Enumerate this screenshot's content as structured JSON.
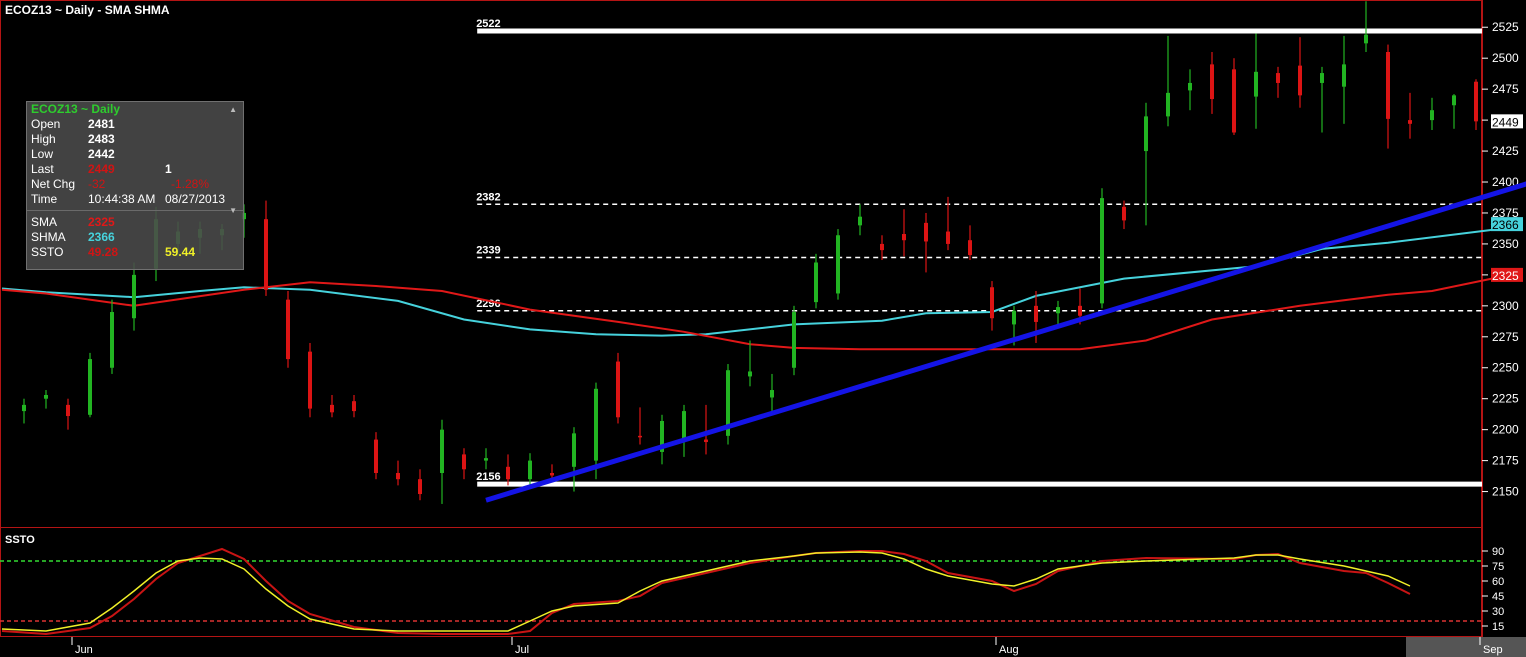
{
  "title": "ECOZ13 ~ Daily  -  SMA SHMA",
  "info_panel": {
    "header": "ECOZ13 ~ Daily",
    "open_label": "Open",
    "open": "2481",
    "high_label": "High",
    "high": "2483",
    "low_label": "Low",
    "low": "2442",
    "last_label": "Last",
    "last": "2449",
    "last_size": "1",
    "netchg_label": "Net Chg",
    "netchg": "-32",
    "netchg_pct": "-1.28%",
    "time_label": "Time",
    "time": "10:44:38 AM",
    "date": "08/27/2013",
    "sma_label": "SMA",
    "sma": "2325",
    "shma_label": "SHMA",
    "shma": "2366",
    "ssto_label": "SSTO",
    "ssto_k": "49.28",
    "ssto_d": "59.44"
  },
  "ssto_panel_label": "SSTO",
  "colors": {
    "up": "#22b422",
    "down": "#dc1414",
    "sma": "#e01818",
    "shma": "#46d2dc",
    "trend": "#1414e6",
    "level": "#ffffff",
    "ssto_k": "#c81414",
    "ssto_d": "#f0f028",
    "ob_line": "#32dc32",
    "os_line": "#dc3232",
    "border": "#b41414"
  },
  "chart_data": {
    "type": "candlestick",
    "price_axis": {
      "range": [
        2123,
        2547
      ],
      "ticks": [
        2150,
        2175,
        2200,
        2225,
        2250,
        2275,
        2300,
        2325,
        2350,
        2375,
        2400,
        2425,
        2450,
        2475,
        2500,
        2525
      ],
      "tick_labels": [
        "2150",
        "2175",
        "2200",
        "2225",
        "2250",
        "2275",
        "2300",
        "2325",
        "2350",
        "2375",
        "2400",
        "2425",
        "2450",
        "2475",
        "2500",
        "2525"
      ]
    },
    "x_labels": [
      {
        "label": "Jun",
        "index": 3
      },
      {
        "label": "Jul",
        "index": 23
      },
      {
        "label": "Aug",
        "index": 45
      },
      {
        "label": "Sep",
        "index": 67
      }
    ],
    "x_range": [
      0,
      68.5
    ],
    "candles": [
      [
        2215,
        2225,
        2205,
        2220
      ],
      [
        2225,
        2232,
        2217,
        2228
      ],
      [
        2220,
        2225,
        2200,
        2211
      ],
      [
        2212,
        2262,
        2210,
        2257
      ],
      [
        2250,
        2305,
        2245,
        2295
      ],
      [
        2290,
        2335,
        2280,
        2325
      ],
      [
        2330,
        2380,
        2320,
        2370
      ],
      [
        2350,
        2368,
        2340,
        2360
      ],
      [
        2355,
        2368,
        2342,
        2362
      ],
      [
        2357,
        2366,
        2345,
        2362
      ],
      [
        2370,
        2382,
        2355,
        2375
      ],
      [
        2370,
        2385,
        2308,
        2313
      ],
      [
        2305,
        2312,
        2250,
        2257
      ],
      [
        2263,
        2270,
        2210,
        2217
      ],
      [
        2220,
        2228,
        2210,
        2214
      ],
      [
        2223,
        2228,
        2210,
        2215
      ],
      [
        2192,
        2198,
        2160,
        2165
      ],
      [
        2165,
        2175,
        2155,
        2160
      ],
      [
        2160,
        2168,
        2143,
        2148
      ],
      [
        2165,
        2208,
        2140,
        2200
      ],
      [
        2180,
        2185,
        2160,
        2168
      ],
      [
        2175,
        2185,
        2168,
        2177
      ],
      [
        2170,
        2180,
        2155,
        2160
      ],
      [
        2160,
        2181,
        2155,
        2175
      ],
      [
        2165,
        2172,
        2158,
        2163
      ],
      [
        2170,
        2202,
        2150,
        2197
      ],
      [
        2175,
        2238,
        2160,
        2233
      ],
      [
        2255,
        2262,
        2205,
        2210
      ],
      [
        2195,
        2218,
        2188,
        2194
      ],
      [
        2182,
        2212,
        2172,
        2207
      ],
      [
        2190,
        2220,
        2178,
        2215
      ],
      [
        2192,
        2220,
        2180,
        2190
      ],
      [
        2195,
        2253,
        2188,
        2248
      ],
      [
        2243,
        2272,
        2235,
        2247
      ],
      [
        2226,
        2245,
        2212,
        2232
      ],
      [
        2250,
        2300,
        2244,
        2295
      ],
      [
        2303,
        2342,
        2298,
        2335
      ],
      [
        2310,
        2362,
        2305,
        2357
      ],
      [
        2365,
        2382,
        2357,
        2372
      ],
      [
        2350,
        2357,
        2337,
        2345
      ],
      [
        2358,
        2378,
        2340,
        2353
      ],
      [
        2367,
        2375,
        2327,
        2352
      ],
      [
        2360,
        2388,
        2345,
        2350
      ],
      [
        2353,
        2365,
        2337,
        2341
      ],
      [
        2315,
        2320,
        2280,
        2290
      ],
      [
        2285,
        2300,
        2268,
        2296
      ],
      [
        2300,
        2312,
        2270,
        2287
      ],
      [
        2294,
        2304,
        2285,
        2299
      ],
      [
        2300,
        2314,
        2285,
        2292
      ],
      [
        2302,
        2395,
        2298,
        2387
      ],
      [
        2380,
        2385,
        2362,
        2369
      ],
      [
        2425,
        2464,
        2365,
        2453
      ],
      [
        2453,
        2518,
        2445,
        2472
      ],
      [
        2474,
        2491,
        2458,
        2480
      ],
      [
        2495,
        2505,
        2455,
        2467
      ],
      [
        2491,
        2500,
        2438,
        2440
      ],
      [
        2469,
        2520,
        2443,
        2489
      ],
      [
        2488,
        2493,
        2468,
        2480
      ],
      [
        2494,
        2517,
        2460,
        2470
      ],
      [
        2480,
        2493,
        2440,
        2488
      ],
      [
        2477,
        2518,
        2447,
        2495
      ],
      [
        2512,
        2546,
        2505,
        2519
      ],
      [
        2505,
        2511,
        2427,
        2451
      ],
      [
        2450,
        2472,
        2435,
        2447
      ],
      [
        2450,
        2468,
        2442,
        2458
      ],
      [
        2462,
        2471,
        2443,
        2470
      ],
      [
        2481,
        2483,
        2442,
        2449
      ]
    ],
    "sma": [
      [
        -1,
        2313
      ],
      [
        1,
        2310
      ],
      [
        5,
        2300
      ],
      [
        10,
        2313
      ],
      [
        13,
        2319
      ],
      [
        16,
        2316
      ],
      [
        19,
        2312
      ],
      [
        23,
        2297
      ],
      [
        27,
        2287
      ],
      [
        30,
        2279
      ],
      [
        33,
        2269
      ],
      [
        35,
        2266
      ],
      [
        38,
        2265
      ],
      [
        44,
        2265
      ],
      [
        48,
        2265
      ],
      [
        51,
        2272
      ],
      [
        54,
        2289
      ],
      [
        58,
        2300
      ],
      [
        62,
        2309
      ],
      [
        64,
        2312
      ],
      [
        67,
        2323
      ]
    ],
    "shma": [
      [
        -1,
        2314
      ],
      [
        1,
        2311
      ],
      [
        5,
        2307
      ],
      [
        8,
        2312
      ],
      [
        10,
        2315
      ],
      [
        13,
        2313
      ],
      [
        17,
        2304
      ],
      [
        20,
        2289
      ],
      [
        23,
        2281
      ],
      [
        26,
        2277
      ],
      [
        29,
        2276
      ],
      [
        31,
        2277
      ],
      [
        35,
        2285
      ],
      [
        39,
        2288
      ],
      [
        41,
        2294
      ],
      [
        44,
        2295
      ],
      [
        46,
        2308
      ],
      [
        50,
        2322
      ],
      [
        56,
        2332
      ],
      [
        59,
        2346
      ],
      [
        62,
        2351
      ],
      [
        67,
        2362
      ]
    ],
    "trend_line": [
      [
        21,
        2143
      ],
      [
        69.5,
        2405
      ]
    ],
    "levels": [
      {
        "value": 2522,
        "label": "2522",
        "from": 20.6,
        "style": "solid"
      },
      {
        "value": 2382,
        "label": "2382",
        "from": 20.6,
        "style": "dashed"
      },
      {
        "value": 2339,
        "label": "2339",
        "from": 20.6,
        "style": "dashed"
      },
      {
        "value": 2296,
        "label": "2296",
        "from": 20.6,
        "style": "dashed"
      },
      {
        "value": 2156,
        "label": "2156",
        "from": 20.6,
        "style": "solid"
      }
    ],
    "price_tags": [
      {
        "value": 2449,
        "label": "2449",
        "from": [
          67,
          2447
        ]
      },
      {
        "value": 2366,
        "label": "2366",
        "from": [
          67,
          2362
        ]
      },
      {
        "value": 2325,
        "label": "2325",
        "from": [
          67,
          2323
        ]
      }
    ],
    "ssto": {
      "range": [
        5,
        100
      ],
      "ticks": [
        90,
        75,
        60,
        45,
        30,
        15
      ],
      "tick_labels": [
        "90",
        "75",
        "60",
        "45",
        "30",
        "15"
      ],
      "overbought": 80,
      "oversold": 20,
      "k": [
        [
          -1,
          10
        ],
        [
          1,
          7
        ],
        [
          3,
          13
        ],
        [
          4,
          25
        ],
        [
          5,
          42
        ],
        [
          6,
          62
        ],
        [
          7,
          78
        ],
        [
          8,
          85
        ],
        [
          9,
          92
        ],
        [
          10,
          82
        ],
        [
          11,
          60
        ],
        [
          12,
          40
        ],
        [
          13,
          27
        ],
        [
          15,
          14
        ],
        [
          17,
          8
        ],
        [
          19,
          7
        ],
        [
          22,
          7
        ],
        [
          23,
          10
        ],
        [
          24,
          28
        ],
        [
          25,
          37
        ],
        [
          27,
          40
        ],
        [
          28,
          45
        ],
        [
          29,
          58
        ],
        [
          31,
          68
        ],
        [
          33,
          78
        ],
        [
          35,
          85
        ],
        [
          36,
          88
        ],
        [
          38,
          90
        ],
        [
          39,
          90
        ],
        [
          40,
          87
        ],
        [
          41,
          80
        ],
        [
          42,
          68
        ],
        [
          44,
          60
        ],
        [
          45,
          50
        ],
        [
          46,
          57
        ],
        [
          47,
          70
        ],
        [
          49,
          80
        ],
        [
          51,
          83
        ],
        [
          55,
          82
        ],
        [
          56,
          86
        ],
        [
          57,
          87
        ],
        [
          58,
          78
        ],
        [
          60,
          70
        ],
        [
          61,
          68
        ],
        [
          62,
          58
        ],
        [
          63,
          47
        ]
      ],
      "d": [
        [
          -1,
          12
        ],
        [
          1,
          10
        ],
        [
          3,
          18
        ],
        [
          4,
          33
        ],
        [
          5,
          50
        ],
        [
          6,
          68
        ],
        [
          7,
          80
        ],
        [
          8,
          83
        ],
        [
          9,
          82
        ],
        [
          10,
          72
        ],
        [
          11,
          52
        ],
        [
          12,
          35
        ],
        [
          13,
          22
        ],
        [
          15,
          12
        ],
        [
          17,
          10
        ],
        [
          19,
          10
        ],
        [
          22,
          10
        ],
        [
          23,
          20
        ],
        [
          24,
          30
        ],
        [
          25,
          35
        ],
        [
          27,
          38
        ],
        [
          28,
          50
        ],
        [
          29,
          60
        ],
        [
          31,
          70
        ],
        [
          33,
          80
        ],
        [
          35,
          85
        ],
        [
          36,
          88
        ],
        [
          38,
          89
        ],
        [
          39,
          88
        ],
        [
          40,
          82
        ],
        [
          41,
          72
        ],
        [
          42,
          65
        ],
        [
          44,
          57
        ],
        [
          45,
          55
        ],
        [
          46,
          62
        ],
        [
          47,
          72
        ],
        [
          49,
          78
        ],
        [
          51,
          80
        ],
        [
          55,
          83
        ],
        [
          56,
          86
        ],
        [
          57,
          86
        ],
        [
          58,
          82
        ],
        [
          60,
          75
        ],
        [
          61,
          70
        ],
        [
          62,
          65
        ],
        [
          63,
          55
        ]
      ]
    }
  }
}
